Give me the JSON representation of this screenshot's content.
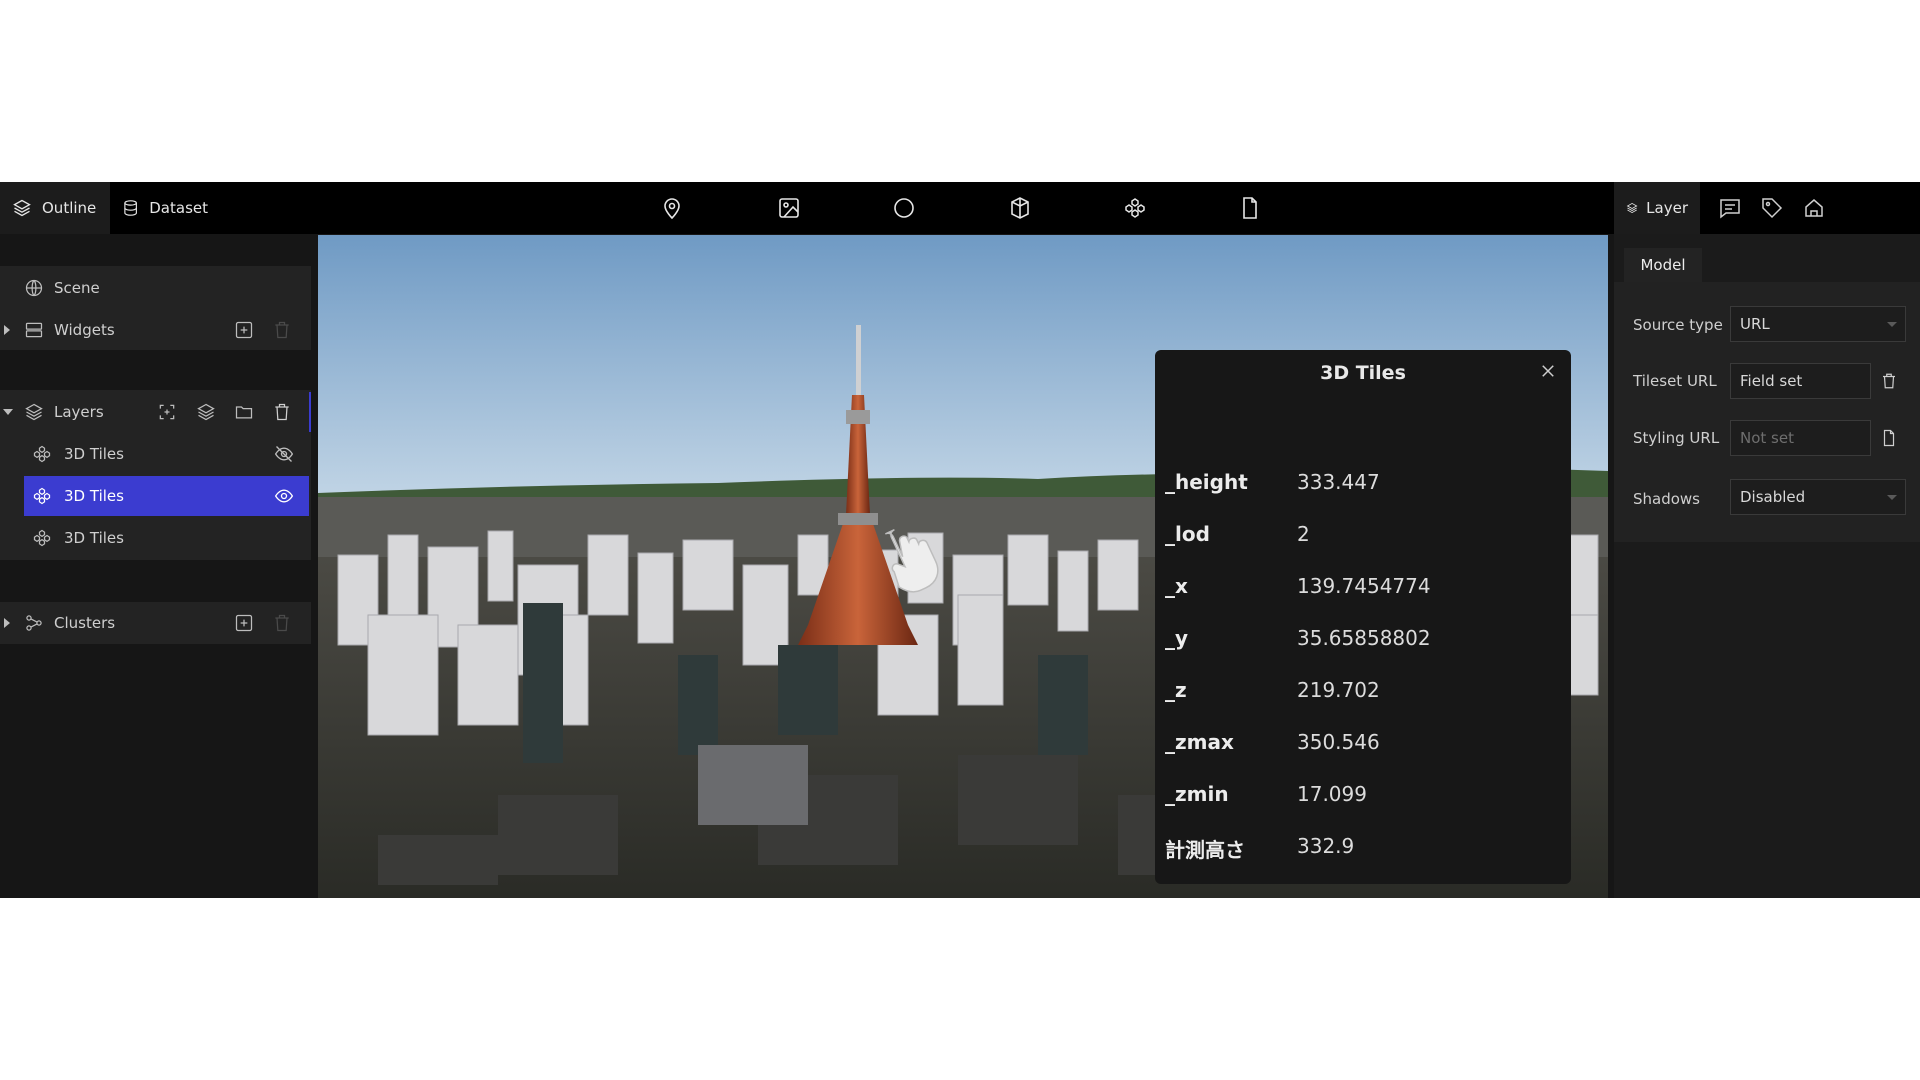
{
  "top_tabs": {
    "outline": "Outline",
    "dataset": "Dataset"
  },
  "toolbar": [
    "map-pin-icon",
    "image-icon",
    "circle-icon",
    "box-icon",
    "tiles-icon",
    "file-icon"
  ],
  "left": {
    "scene": "Scene",
    "widgets": "Widgets",
    "layers": "Layers",
    "layer_items": [
      "3D Tiles",
      "3D Tiles",
      "3D Tiles"
    ],
    "clusters": "Clusters"
  },
  "popup": {
    "title": "3D Tiles",
    "rows": [
      {
        "key": "_height",
        "value": "333.447"
      },
      {
        "key": "_lod",
        "value": "2"
      },
      {
        "key": "_x",
        "value": "139.7454774"
      },
      {
        "key": "_y",
        "value": "35.65858802"
      },
      {
        "key": "_z",
        "value": "219.702"
      },
      {
        "key": "_zmax",
        "value": "350.546"
      },
      {
        "key": "_zmin",
        "value": "17.099"
      },
      {
        "key": "計測高さ",
        "value": "332.9"
      }
    ]
  },
  "right": {
    "layer_tab": "Layer",
    "model_tab": "Model",
    "source_type_label": "Source type",
    "source_type_value": "URL",
    "tileset_url_label": "Tileset URL",
    "tileset_url_value": "Field set",
    "styling_url_label": "Styling URL",
    "styling_url_placeholder": "Not set",
    "shadows_label": "Shadows",
    "shadows_value": "Disabled"
  },
  "colors": {
    "accent": "#3b3cd0",
    "panel": "#161616",
    "bar": "#000000"
  }
}
